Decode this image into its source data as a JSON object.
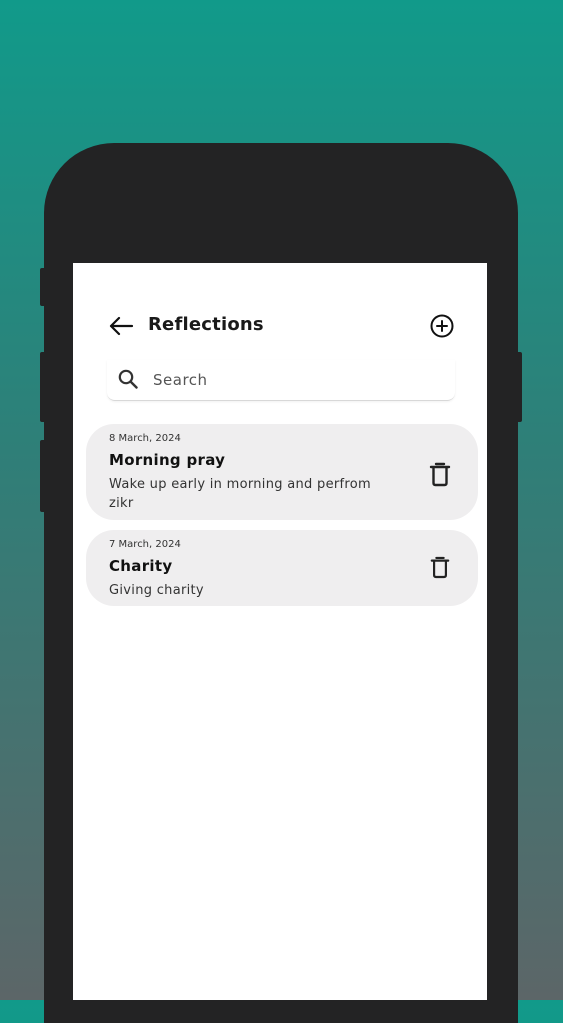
{
  "header": {
    "title": "Reflections",
    "back_icon": "arrow-left-icon",
    "add_icon": "plus-circle-icon"
  },
  "search": {
    "placeholder": "Search",
    "value": "",
    "icon": "search-icon"
  },
  "reflections": [
    {
      "date": "8 March, 2024",
      "title": "Morning pray",
      "description": "Wake up early in morning and perfrom zikr",
      "delete_icon": "trash-icon"
    },
    {
      "date": "7 March, 2024",
      "title": "Charity",
      "description": "Giving charity",
      "delete_icon": "trash-icon"
    }
  ],
  "colors": {
    "background_top": "#119a8a",
    "background_bottom": "#5c6668",
    "phone_frame": "#232324",
    "card_background": "#efeeef"
  }
}
